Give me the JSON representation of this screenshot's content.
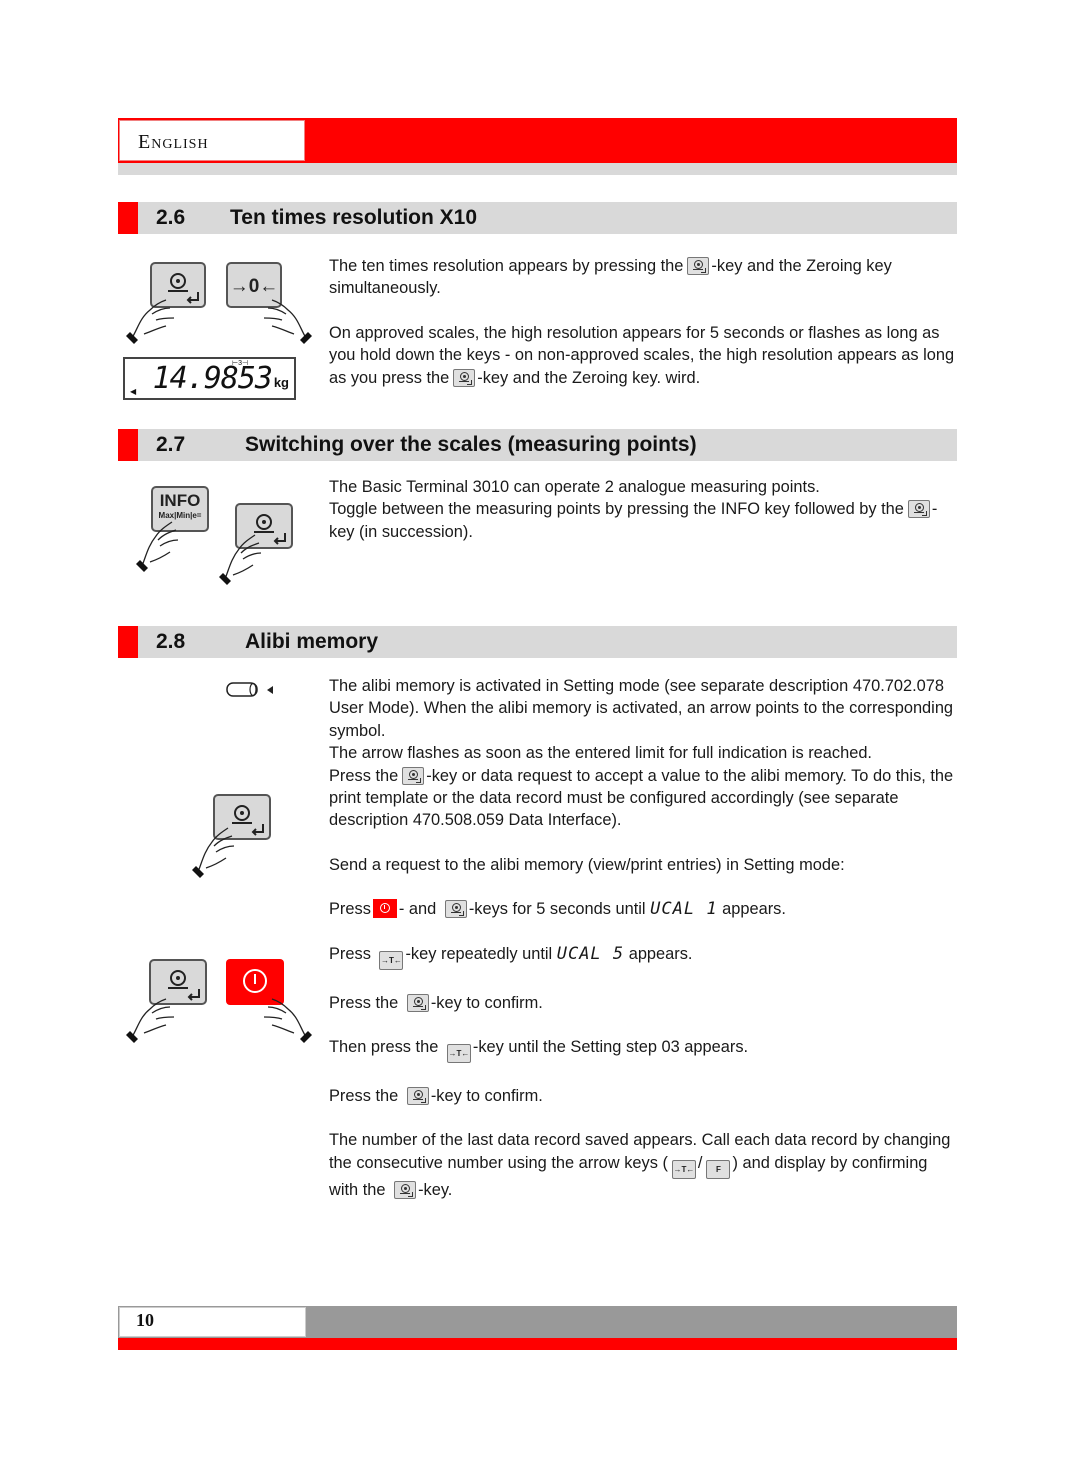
{
  "header": {
    "language": "English"
  },
  "sections": [
    {
      "number": "2.6",
      "title": "Ten times resolution X10",
      "paragraphs": {
        "p1a": "The ten times resolution appears by pressing the",
        "p1b": "-key and the Zeroing key simultaneously.",
        "p2a": "On approved scales, the high resolution appears for 5 seconds or flashes as long as you hold down the keys - on non-approved scales, the high resolution appears as long as you press the",
        "p2b": "-key and the Zeroing key. wird."
      },
      "illustration": {
        "key_left_icon": "print-enter-key",
        "key_right_label": "→0←",
        "display_value": "14.9853",
        "display_unit": "kg",
        "display_mark": "⊢3⊣"
      }
    },
    {
      "number": "2.7",
      "title": "Switching over the scales (measuring points)",
      "paragraphs": {
        "p1": "The Basic Terminal 3010 can operate 2 analogue measuring points.",
        "p2a": "Toggle between the measuring points by pressing the INFO key followed by the",
        "p2b": "-key (in succession)."
      },
      "illustration": {
        "info_key_label": "INFO",
        "info_key_sub": "Max|Min|e="
      }
    },
    {
      "number": "2.8",
      "title": "Alibi memory",
      "paragraphs": {
        "p1": "The alibi memory is activated in Setting mode (see separate description 470.702.078 User Mode). When the alibi memory is activated, an arrow points to the corresponding symbol.",
        "p2": "The arrow flashes as soon as the entered limit for full indication is reached.",
        "p3a": "Press the",
        "p3b": "-key or data request to accept a value to the alibi memory. To do this, the print template or the data record must be configured accordingly (see separate description 470.508.059 Data Interface).",
        "p4": "Send a request to the alibi memory (view/print entries) in Setting mode:",
        "s1a": "Press",
        "s1b": "- and",
        "s1c": "-keys for 5 seconds until",
        "s1d": "UCAL 1",
        "s1e": "appears.",
        "s2a": "Press",
        "s2b": "-key  repeatedly until",
        "s2c": "UCAL 5",
        "s2d": "appears.",
        "s3a": "Press the",
        "s3b": "-key to confirm.",
        "s4a": "Then press the",
        "s4b": "-key until the Setting step 03 appears.",
        "s5a": "Press the",
        "s5b": "-key to confirm.",
        "p5a": "The number of the last data record saved appears. Call each data record by changing the consecutive number using the arrow keys (",
        "p5b": "/",
        "p5c": ")  and display by confirming with the",
        "p5d": "-key."
      },
      "keys": {
        "tare_label": "→T←",
        "f_label": "F"
      }
    }
  ],
  "footer": {
    "page_number": "10"
  },
  "colors": {
    "accent_red": "#ff0000",
    "band_grey": "#d9d9d9",
    "footer_grey": "#999999"
  }
}
